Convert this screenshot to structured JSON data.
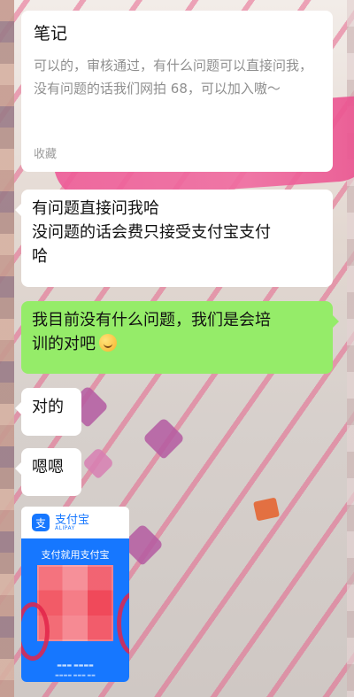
{
  "note_card": {
    "title": "笔记",
    "body": "可以的，审核通过，有什么问题可以直接问我，没有问题的话我们网拍 68，可以加入嗷～",
    "footer": "收藏"
  },
  "messages": [
    {
      "side": "left",
      "lines": [
        "有问题直接问我哈",
        "没问题的话会费只接受支付宝支付",
        "哈"
      ]
    },
    {
      "side": "right",
      "lines": [
        "我目前没有什么问题，我们是会培",
        "训的对吧"
      ],
      "emoji": "smile-emoji"
    },
    {
      "side": "left",
      "lines": [
        "对的"
      ]
    },
    {
      "side": "left",
      "lines": [
        "嗯嗯"
      ]
    }
  ],
  "alipay_card": {
    "logo_icon": "alipay-logo-icon",
    "brand_name": "支付宝",
    "brand_sub": "ALIPAY",
    "title": "支付就用支付宝"
  },
  "colors": {
    "green_bubble": "#95ec69",
    "white_bubble": "#ffffff",
    "alipay_blue": "#1677ff"
  }
}
